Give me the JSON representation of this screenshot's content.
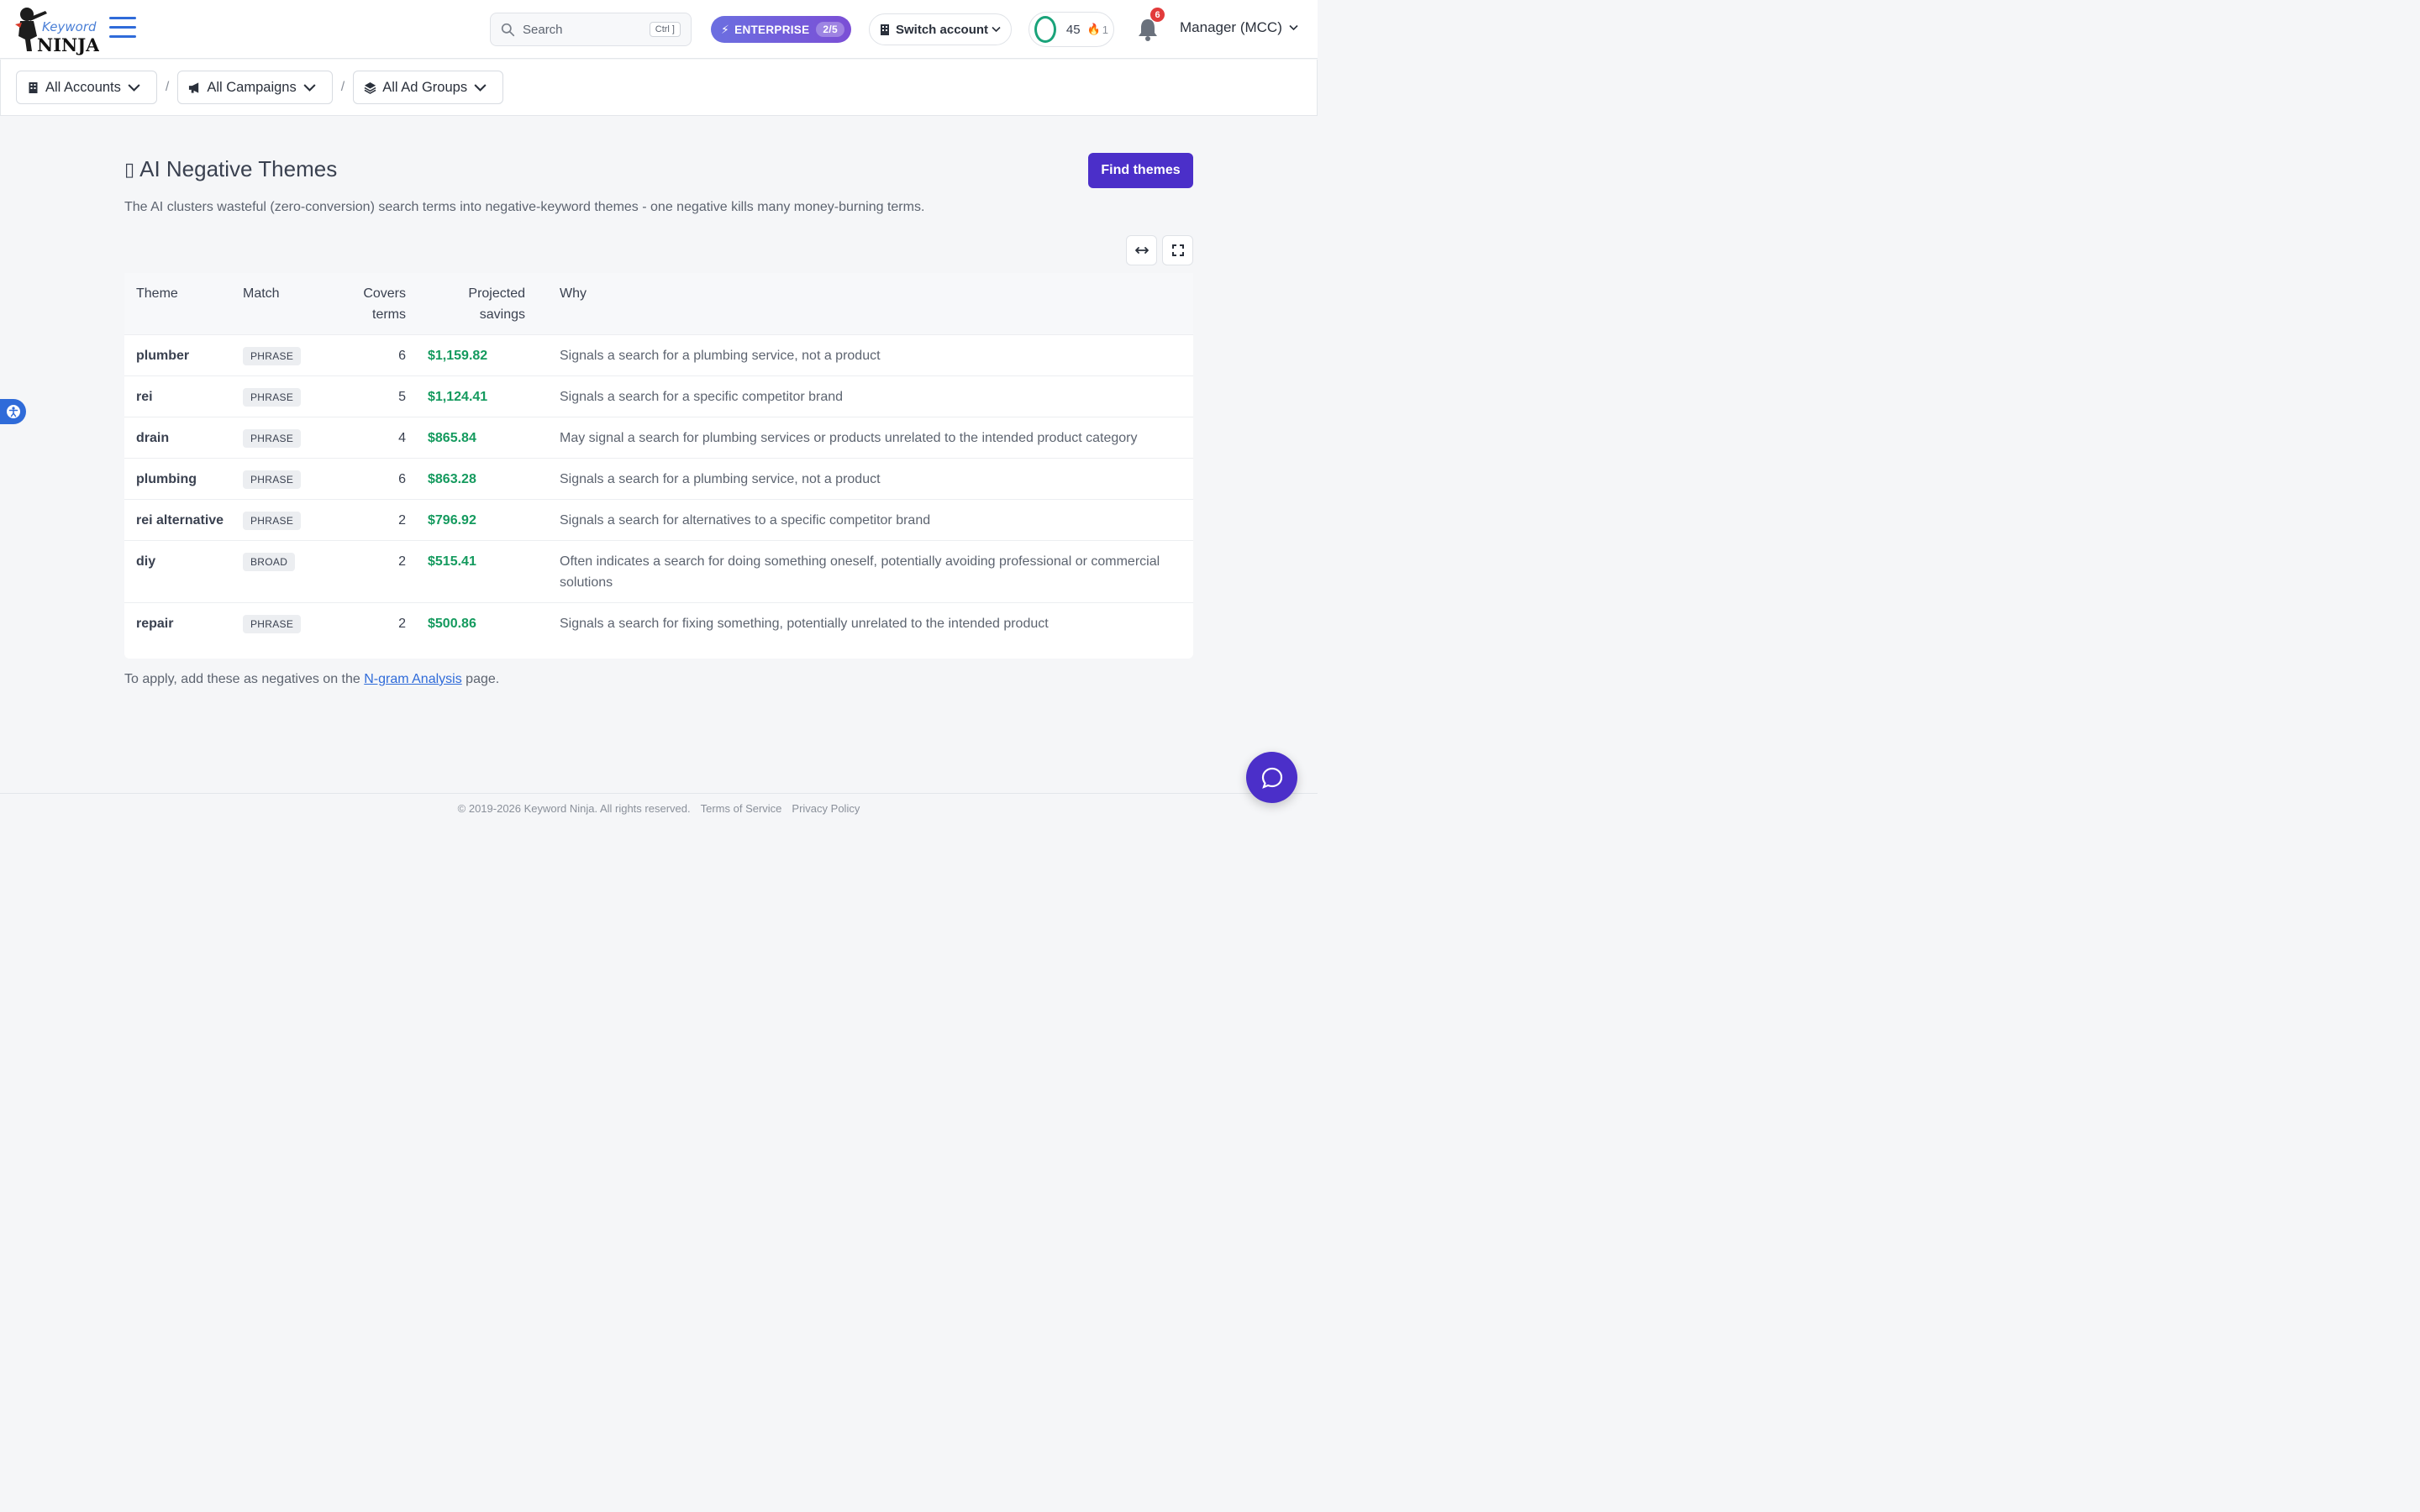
{
  "header": {
    "logo_top": "Keyword",
    "logo_bottom": "NINJA",
    "search_placeholder": "Search",
    "search_shortcut": "Ctrl ]",
    "plan_label": "ENTERPRISE",
    "plan_count": "2/5",
    "switch_account_label": "Switch account",
    "score": "45",
    "streak": "1",
    "notification_count": "6",
    "account_name": "Manager (MCC)"
  },
  "breadcrumb": {
    "accounts": "All Accounts",
    "campaigns": "All Campaigns",
    "ad_groups": "All Ad Groups",
    "separator": "/"
  },
  "page": {
    "title_glyph": "▯",
    "title": "AI Negative Themes",
    "find_button": "Find themes",
    "description": "The AI clusters wasteful (zero-conversion) search terms into negative-keyword themes - one negative kills many money-burning terms."
  },
  "table": {
    "headers": {
      "theme": "Theme",
      "match": "Match",
      "covers_line1": "Covers",
      "covers_line2": "terms",
      "projected_line1": "Projected",
      "projected_line2": "savings",
      "why": "Why"
    },
    "rows": [
      {
        "theme": "plumber",
        "match": "PHRASE",
        "covers": "6",
        "savings": "$1,159.82",
        "why": "Signals a search for a plumbing service, not a product"
      },
      {
        "theme": "rei",
        "match": "PHRASE",
        "covers": "5",
        "savings": "$1,124.41",
        "why": "Signals a search for a specific competitor brand"
      },
      {
        "theme": "drain",
        "match": "PHRASE",
        "covers": "4",
        "savings": "$865.84",
        "why": "May signal a search for plumbing services or products unrelated to the intended product category"
      },
      {
        "theme": "plumbing",
        "match": "PHRASE",
        "covers": "6",
        "savings": "$863.28",
        "why": "Signals a search for a plumbing service, not a product"
      },
      {
        "theme": "rei alternative",
        "match": "PHRASE",
        "covers": "2",
        "savings": "$796.92",
        "why": "Signals a search for alternatives to a specific competitor brand"
      },
      {
        "theme": "diy",
        "match": "BROAD",
        "covers": "2",
        "savings": "$515.41",
        "why": "Often indicates a search for doing something oneself, potentially avoiding professional or commercial solutions"
      },
      {
        "theme": "repair",
        "match": "PHRASE",
        "covers": "2",
        "savings": "$500.86",
        "why": "Signals a search for fixing something, potentially unrelated to the intended product"
      }
    ]
  },
  "footnote": {
    "before": "To apply, add these as negatives on the ",
    "link": "N-gram Analysis",
    "after": " page."
  },
  "footer": {
    "copyright": "© 2019-2026 Keyword Ninja. All rights reserved.",
    "terms": "Terms of Service",
    "privacy": "Privacy Policy"
  },
  "colors": {
    "accent": "#4b2fc9",
    "link": "#2f6bd9",
    "money": "#149a5e",
    "notification": "#e23b3b"
  },
  "icons": [
    "ninja-logo",
    "hamburger-icon",
    "search-icon",
    "bolt-icon",
    "building-icon",
    "chevron-down-icon",
    "score-ring-icon",
    "flame-icon",
    "bell-icon",
    "megaphone-icon",
    "layers-icon",
    "expand-width-icon",
    "fullscreen-icon",
    "accessibility-icon",
    "chat-icon"
  ]
}
